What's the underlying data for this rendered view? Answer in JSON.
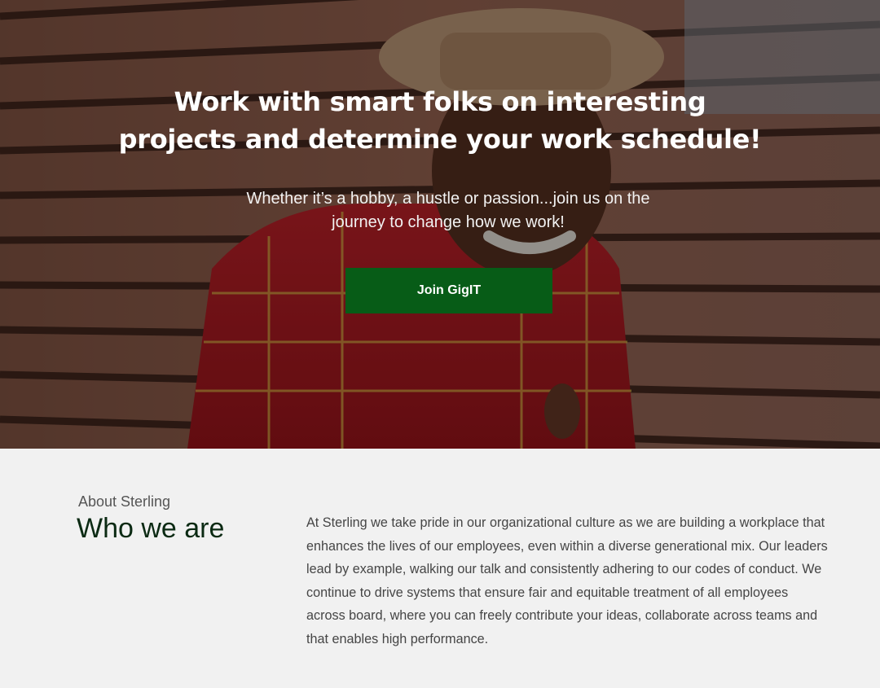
{
  "hero": {
    "title": "Work with smart folks on interesting projects and determine your work schedule!",
    "subtitle": "Whether it’s a hobby, a hustle or passion...join us on the journey to change how we work!",
    "cta_label": "Join GigIT",
    "image_subject": "photo-person-smiling-hat",
    "colors": {
      "cta_background": "#075c17",
      "text": "#ffffff"
    }
  },
  "about": {
    "eyebrow": "About Sterling",
    "heading": "Who we are",
    "body": "At Sterling we take pride in our organizational culture as we are building a workplace that enhances the lives of our employees, even within a diverse generational mix. Our leaders lead by example, walking our talk and consistently adhering to our codes of conduct. We continue to drive systems that ensure fair and equitable treatment of all employees across board, where you can freely contribute your ideas, collaborate across teams and that enables high performance.",
    "colors": {
      "background": "#f1f1f1",
      "heading": "#0b2a13",
      "body": "#454545"
    }
  }
}
